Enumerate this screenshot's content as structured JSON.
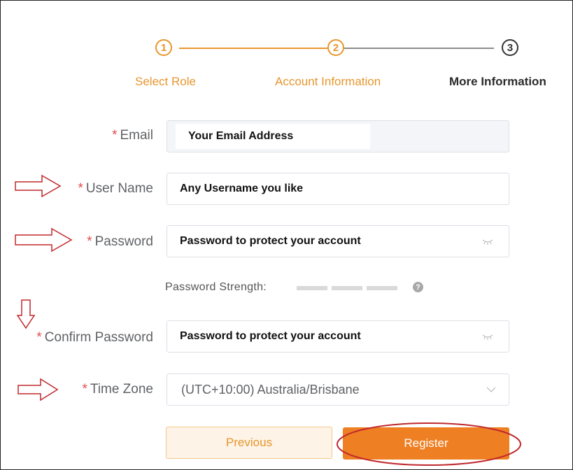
{
  "stepper": {
    "steps": [
      {
        "number": "1",
        "label": "Select Role",
        "state": "done"
      },
      {
        "number": "2",
        "label": "Account Information",
        "state": "done"
      },
      {
        "number": "3",
        "label": "More Information",
        "state": "current"
      }
    ]
  },
  "form": {
    "required_mark": "*",
    "email": {
      "label": "Email",
      "value": "Your Email Address"
    },
    "username": {
      "label": "User Name",
      "value": "Any Username you like"
    },
    "password": {
      "label": "Password",
      "value": "Password to protect your account"
    },
    "password_strength": {
      "label": "Password Strength:",
      "help": "?"
    },
    "confirm_password": {
      "label": "Confirm Password",
      "value": "Password to protect your account"
    },
    "timezone": {
      "label": "Time Zone",
      "value": "(UTC+10:00) Australia/Brisbane"
    }
  },
  "buttons": {
    "previous": "Previous",
    "register": "Register"
  },
  "colors": {
    "accent": "#e8962e",
    "register_bg": "#ee7f22",
    "required": "#e34b4b",
    "annotation": "#c0282d"
  },
  "icons": {
    "password_toggle": "eye-closed-icon",
    "timezone_dropdown": "chevron-down-icon",
    "strength_help": "question-circle-icon"
  }
}
